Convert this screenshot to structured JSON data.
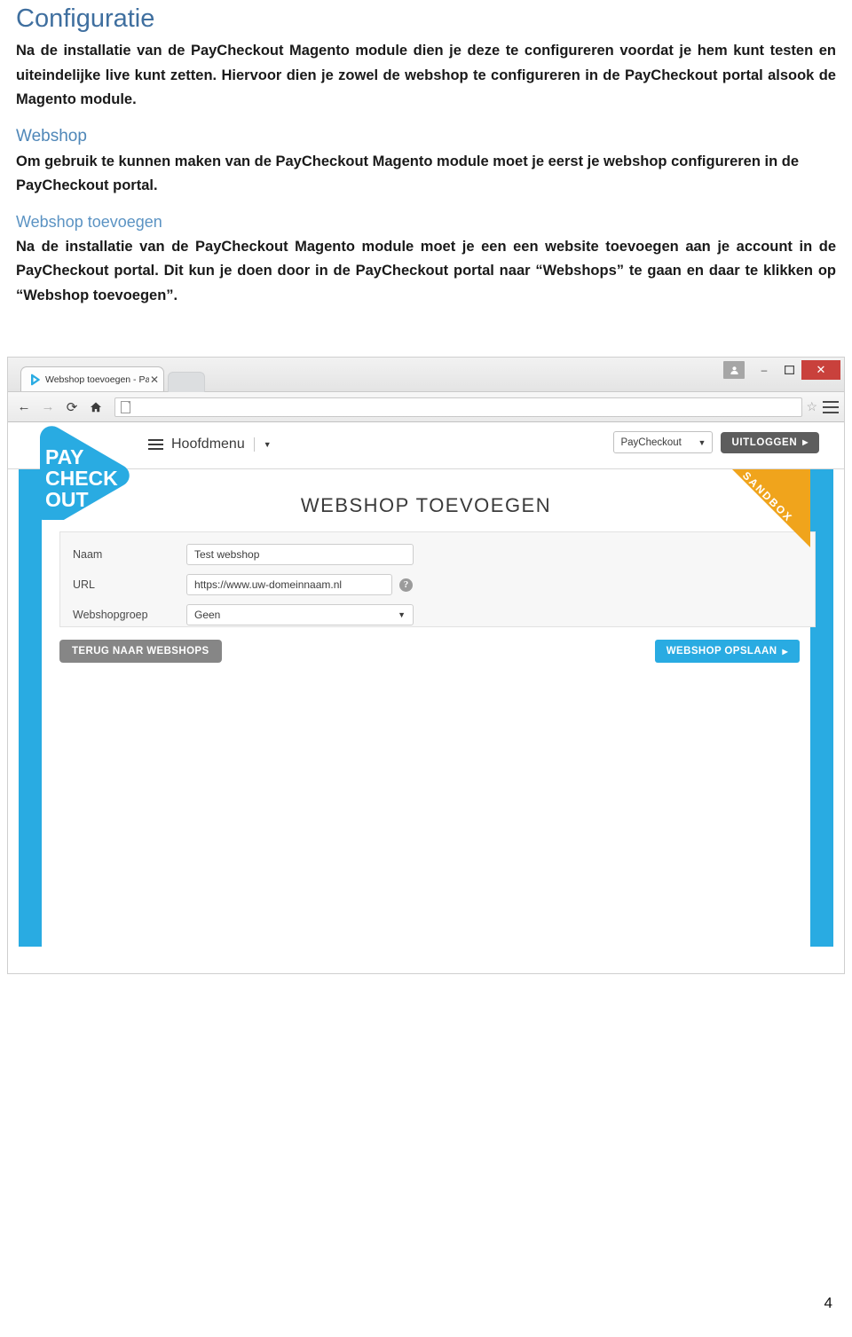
{
  "document": {
    "title": "Configuratie",
    "intro": "Na de installatie van de PayCheckout Magento module dien je deze te configureren voordat je hem kunt testen en uiteindelijke live kunt zetten. Hiervoor dien je zowel de webshop te configureren in de PayCheckout portal alsook de Magento module.",
    "section_webshop_heading": "Webshop",
    "section_webshop_body": "Om gebruik te kunnen maken van de PayCheckout Magento module moet je eerst je webshop configureren in de PayCheckout portal.",
    "section_toevoegen_heading": "Webshop toevoegen",
    "section_toevoegen_body": "Na de installatie van de PayCheckout Magento module moet je een een website toevoegen aan je account in de PayCheckout portal. Dit kun je doen door in de PayCheckout portal naar “Webshops” te gaan en daar te klikken op “Webshop toevoegen”.",
    "page_number": "4",
    "heading_color": "#3f6f9f",
    "subheading_color": "#5b93c3"
  },
  "browser": {
    "tab_title": "Webshop toevoegen - Pa",
    "tab_close_label": "✕",
    "nav": {
      "back": "←",
      "forward": "→",
      "reload": "⟳",
      "home": "⌂"
    },
    "address_value": "",
    "address_placeholder": "",
    "bookmark_icon": "☆",
    "menu_icon": "hamburger-icon",
    "window_controls": {
      "user": "■",
      "minimize": "–",
      "maximize": "❐",
      "close": "✕"
    }
  },
  "app": {
    "logo": {
      "line1": "PAY",
      "line2": "CHECK",
      "line3": "OUT",
      "color": "#29abe2"
    },
    "nav": {
      "main_menu_label": "Hoofdmenu",
      "caret": "▼"
    },
    "header": {
      "account_select_value": "PayCheckout",
      "account_select_caret": "▼",
      "logout_label": "UITLOGGEN",
      "logout_caret": "▶"
    },
    "ribbon": {
      "label": "SANDBOX",
      "color": "#f0a41c"
    },
    "page_title": "WEBSHOP TOEVOEGEN",
    "form": {
      "fields": [
        {
          "label": "Naam",
          "value": "Test webshop",
          "type": "text"
        },
        {
          "label": "URL",
          "value": "https://www.uw-domeinnaam.nl",
          "type": "text",
          "help": "?"
        },
        {
          "label": "Webshopgroep",
          "value": "Geen",
          "type": "select",
          "caret": "▼"
        }
      ]
    },
    "buttons": {
      "back_label": "TERUG NAAR WEBSHOPS",
      "save_label": "WEBSHOP OPSLAAN",
      "save_caret": "▶"
    },
    "accent_color": "#29abe2"
  }
}
